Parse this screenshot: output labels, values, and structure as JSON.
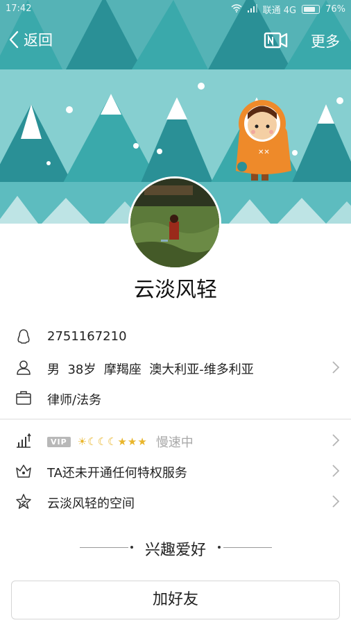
{
  "status_bar": {
    "time": "17:42",
    "carrier": "联通 4G",
    "battery": "76%"
  },
  "nav": {
    "back_label": "返回",
    "more_label": "更多",
    "video_icon": "video-call-icon"
  },
  "profile": {
    "nickname": "云淡风轻"
  },
  "info": {
    "qq_number": "2751167210",
    "gender": "男",
    "age": "38岁",
    "zodiac": "摩羯座",
    "location": "澳大利亚-维多利亚",
    "occupation": "律师/法务"
  },
  "services": {
    "vip_badge": "VIP",
    "level_icons": "☀☾☾☾★★★",
    "speed_status": "慢速中",
    "privilege_text": "TA还未开通任何特权服务",
    "space_text": "云淡风轻的空间"
  },
  "hobby": {
    "title": "兴趣爱好"
  },
  "actions": {
    "add_friend": "加好友"
  },
  "colors": {
    "teal_bg": "#86cfd0",
    "tree_dark": "#2a9096",
    "tree_mid": "#3aa9ab",
    "snow": "#ffffff",
    "orange": "#ee8a2a",
    "gold": "#e9b52a"
  }
}
